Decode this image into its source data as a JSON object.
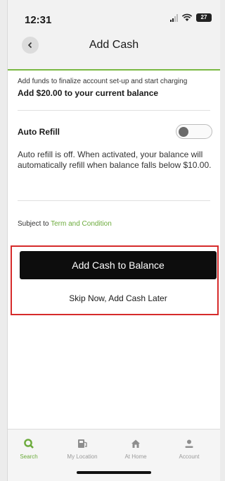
{
  "status_bar": {
    "time": "12:31",
    "battery_level": "27"
  },
  "header": {
    "title": "Add Cash"
  },
  "intro": {
    "text": "Add funds to finalize account set-up and start charging",
    "amount_line": "Add $20.00 to your current balance"
  },
  "auto_refill": {
    "label": "Auto Refill",
    "enabled": false,
    "description": "Auto refill is off. When activated, your balance will automatically refill when balance falls below $10.00."
  },
  "terms": {
    "prefix": "Subject to",
    "link_text": "Term and Condition"
  },
  "actions": {
    "primary_label": "Add Cash to Balance",
    "secondary_label": "Skip Now, Add Cash Later"
  },
  "tabbar": {
    "items": [
      {
        "label": "Search",
        "icon": "search-icon",
        "active": true
      },
      {
        "label": "My Location",
        "icon": "location-icon",
        "active": false
      },
      {
        "label": "At Home",
        "icon": "home-icon",
        "active": false
      },
      {
        "label": "Account",
        "icon": "account-icon",
        "active": false
      }
    ]
  },
  "colors": {
    "accent_green": "#6cab3c",
    "primary_button": "#0d0d0d",
    "highlight_red": "#d62b2b"
  }
}
